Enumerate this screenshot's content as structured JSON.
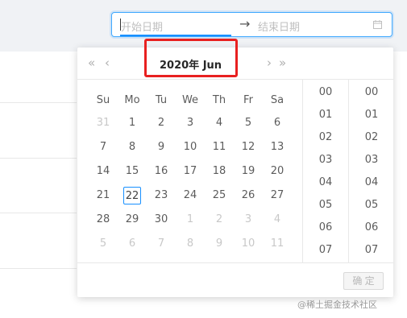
{
  "range": {
    "start_placeholder": "开始日期",
    "arrow": "→",
    "end_placeholder": "结束日期",
    "icon": "calendar-icon"
  },
  "header": {
    "super_prev": "«",
    "prev": "‹",
    "title": "2020年  Jun",
    "next": "›",
    "super_next": "»"
  },
  "weekdays": [
    "Su",
    "Mo",
    "Tu",
    "We",
    "Th",
    "Fr",
    "Sa"
  ],
  "weeks": [
    [
      "31",
      "1",
      "2",
      "3",
      "4",
      "5",
      "6"
    ],
    [
      "7",
      "8",
      "9",
      "10",
      "11",
      "12",
      "13"
    ],
    [
      "14",
      "15",
      "16",
      "17",
      "18",
      "19",
      "20"
    ],
    [
      "21",
      "22",
      "23",
      "24",
      "25",
      "26",
      "27"
    ],
    [
      "28",
      "29",
      "30",
      "1",
      "2",
      "3",
      "4"
    ],
    [
      "5",
      "6",
      "7",
      "8",
      "9",
      "10",
      "11"
    ]
  ],
  "today": "22",
  "hours": [
    "00",
    "01",
    "02",
    "03",
    "04",
    "05",
    "06",
    "07"
  ],
  "minutes": [
    "00",
    "01",
    "02",
    "03",
    "04",
    "05",
    "06",
    "07"
  ],
  "ok_label": "确 定",
  "watermark": "@稀土掘金技术社区",
  "colors": {
    "accent": "#1890ff",
    "highlight": "#e82020"
  }
}
